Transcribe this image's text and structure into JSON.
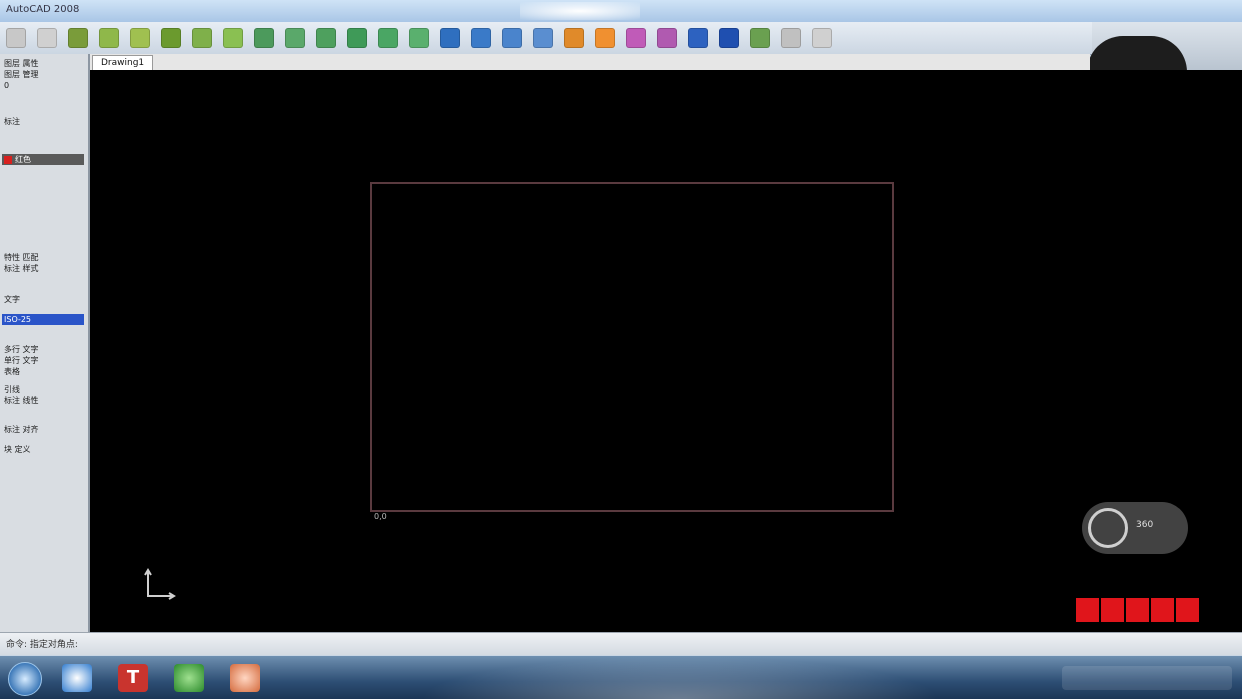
{
  "window": {
    "title": "AutoCAD 2008"
  },
  "toolbar": {
    "button_colors": [
      "#c8c8c8",
      "#d0d0d0",
      "#7a9c3a",
      "#8fb84a",
      "#a0c050",
      "#6b9a2e",
      "#7fb04a",
      "#8ac052",
      "#4c9a5c",
      "#5aa86a",
      "#4ea05e",
      "#3f9a58",
      "#4aa664",
      "#5ab06e",
      "#2f6fbf",
      "#3a7ac8",
      "#4a84cc",
      "#5a8ed0",
      "#e08a2a",
      "#f09030",
      "#c05bb8",
      "#b05ab0",
      "#2d62c0",
      "#1f4fb0",
      "#6aa050",
      "#c0c0c0",
      "#d0d0d0"
    ]
  },
  "tabs": {
    "drawing_tab": "Drawing1"
  },
  "left_panel": {
    "items": [
      {
        "label": "图层 属性",
        "state": "normal"
      },
      {
        "label": "图层 管理",
        "state": "normal"
      },
      {
        "label": "0",
        "state": "normal"
      },
      {
        "label": "标注",
        "state": "normal"
      },
      {
        "label": "红色",
        "state": "red"
      },
      {
        "label": "特性 匹配",
        "state": "normal"
      },
      {
        "label": "标注 样式",
        "state": "normal"
      },
      {
        "label": "文字",
        "state": "normal"
      },
      {
        "label": "ISO-25",
        "state": "selected"
      },
      {
        "label": "多行 文字",
        "state": "normal"
      },
      {
        "label": "单行 文字",
        "state": "normal"
      },
      {
        "label": "表格",
        "state": "normal"
      },
      {
        "label": "引线",
        "state": "normal"
      },
      {
        "label": "标注 线性",
        "state": "normal"
      },
      {
        "label": "标注 对齐",
        "state": "normal"
      },
      {
        "label": "块 定义",
        "state": "normal"
      }
    ]
  },
  "canvas": {
    "background": "#000000",
    "rect_color": "#5a3a3f",
    "rect_label": "0,0"
  },
  "nav_wheel": {
    "label": "360"
  },
  "status": {
    "text": "命令: 指定对角点:"
  },
  "taskbar": {
    "app1_label": "T"
  }
}
